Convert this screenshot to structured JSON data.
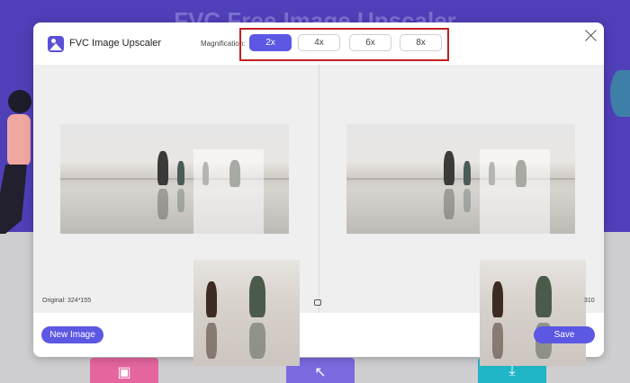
{
  "background": {
    "title": "FVC Free Image Upscaler",
    "accent": "#4f3fb8"
  },
  "dialog": {
    "app_title": "FVC Image Upscaler",
    "app_icon": "image-icon",
    "magnification_label": "Magnification:",
    "magnification_options": [
      "2x",
      "4x",
      "6x",
      "8x"
    ],
    "selected_magnification": "2x",
    "close_icon": "close-icon",
    "original_info": "Original: 324*155",
    "output_info": "310",
    "buttons": {
      "new_image": "New Image",
      "save": "Save"
    },
    "accent_color": "#5c58e3",
    "highlight_color": "#c21f24"
  }
}
